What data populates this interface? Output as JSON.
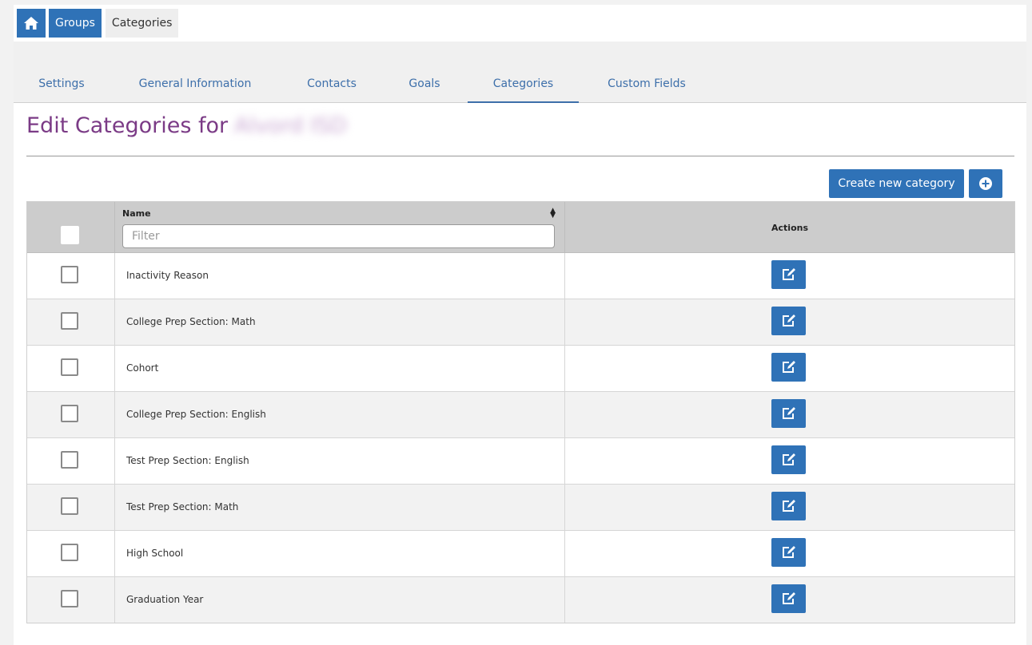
{
  "breadcrumb": {
    "home_icon": "home-icon",
    "groups": "Groups",
    "current": "Categories"
  },
  "tabs": [
    {
      "label": "Settings",
      "active": false
    },
    {
      "label": "General Information",
      "active": false
    },
    {
      "label": "Contacts",
      "active": false
    },
    {
      "label": "Goals",
      "active": false
    },
    {
      "label": "Categories",
      "active": true
    },
    {
      "label": "Custom Fields",
      "active": false
    }
  ],
  "page": {
    "title": "Edit Categories for",
    "title_redacted": "Alvord ISD"
  },
  "toolbar": {
    "create_label": "Create new category",
    "add_icon": "plus-circle-icon"
  },
  "table": {
    "columns": {
      "name": "Name",
      "actions": "Actions"
    },
    "filter_placeholder": "Filter",
    "rows": [
      {
        "name": "Inactivity Reason"
      },
      {
        "name": "College Prep Section: Math"
      },
      {
        "name": "Cohort"
      },
      {
        "name": "College Prep Section: English"
      },
      {
        "name": "Test Prep Section: English"
      },
      {
        "name": "Test Prep Section: Math"
      },
      {
        "name": "High School"
      },
      {
        "name": "Graduation Year"
      }
    ],
    "edit_icon": "edit-icon"
  },
  "colors": {
    "primary": "#2f72b7",
    "title": "#7b3b86",
    "tab_text": "#3d6faa"
  }
}
